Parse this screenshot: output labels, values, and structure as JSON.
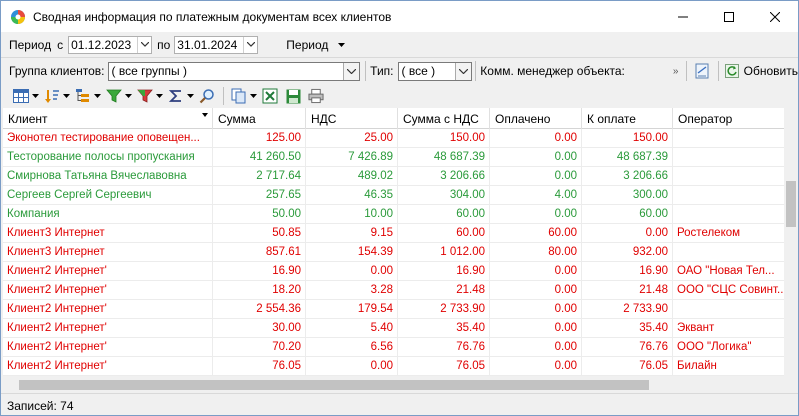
{
  "window": {
    "title": "Сводная информация по платежным документам всех клиентов"
  },
  "period": {
    "label": "Период",
    "from_label": "с",
    "from_value": "01.12.2023",
    "to_label": "по",
    "to_value": "31.01.2024",
    "menu_label": "Период"
  },
  "filters": {
    "group_label": "Группа клиентов:",
    "group_value": "( все группы )",
    "type_label": "Тип:",
    "type_value": "( все )",
    "manager_label": "Комм. менеджер объекта:",
    "refresh_label": "Обновить"
  },
  "icons": {
    "toolbar": [
      "table-config-icon",
      "sort-icon",
      "group-tree-icon",
      "filter-icon",
      "filter-color-icon",
      "sum-icon",
      "find-icon",
      "copy-icon",
      "excel-export-icon",
      "save-icon",
      "print-icon"
    ]
  },
  "colors": {
    "red": "#e00000",
    "green": "#2a9a3a"
  },
  "table": {
    "columns": [
      "Клиент",
      "Сумма",
      "НДС",
      "Сумма с НДС",
      "Оплачено",
      "К оплате",
      "Оператор"
    ],
    "rows": [
      {
        "c": [
          "Эконотел тестирование оповещен...",
          "125.00",
          "25.00",
          "150.00",
          "0.00",
          "150.00",
          ""
        ],
        "color": "red"
      },
      {
        "c": [
          "Тесторование полосы пропускания",
          "41 260.50",
          "7 426.89",
          "48 687.39",
          "0.00",
          "48 687.39",
          ""
        ],
        "color": "green"
      },
      {
        "c": [
          "Смирнова Татьяна Вячеславовна",
          "2 717.64",
          "489.02",
          "3 206.66",
          "0.00",
          "3 206.66",
          ""
        ],
        "color": "green"
      },
      {
        "c": [
          "Сергеев Сергей Сергеевич",
          "257.65",
          "46.35",
          "304.00",
          "4.00",
          "300.00",
          ""
        ],
        "color": "green"
      },
      {
        "c": [
          "Компания",
          "50.00",
          "10.00",
          "60.00",
          "0.00",
          "60.00",
          ""
        ],
        "color": "green"
      },
      {
        "c": [
          "Клиент3 Интернет",
          "50.85",
          "9.15",
          "60.00",
          "60.00",
          "0.00",
          "Ростелеком"
        ],
        "color": "red"
      },
      {
        "c": [
          "Клиент3 Интернет",
          "857.61",
          "154.39",
          "1 012.00",
          "80.00",
          "932.00",
          ""
        ],
        "color": "red"
      },
      {
        "c": [
          "Клиент2 Интернет'",
          "16.90",
          "0.00",
          "16.90",
          "0.00",
          "16.90",
          "ОАО \"Новая Тел..."
        ],
        "color": "red"
      },
      {
        "c": [
          "Клиент2 Интернет'",
          "18.20",
          "3.28",
          "21.48",
          "0.00",
          "21.48",
          "ООО \"СЦС Совинт..."
        ],
        "color": "red"
      },
      {
        "c": [
          "Клиент2 Интернет'",
          "2 554.36",
          "179.54",
          "2 733.90",
          "0.00",
          "2 733.90",
          ""
        ],
        "color": "red"
      },
      {
        "c": [
          "Клиент2 Интернет'",
          "30.00",
          "5.40",
          "35.40",
          "0.00",
          "35.40",
          "Эквант"
        ],
        "color": "red"
      },
      {
        "c": [
          "Клиент2 Интернет'",
          "70.20",
          "6.56",
          "76.76",
          "0.00",
          "76.76",
          "ООО \"Логика\""
        ],
        "color": "red"
      },
      {
        "c": [
          "Клиент2 Интернет'",
          "76.05",
          "0.00",
          "76.05",
          "0.00",
          "76.05",
          "Билайн"
        ],
        "color": "red"
      }
    ]
  },
  "status": {
    "records": "Записей: 74"
  }
}
